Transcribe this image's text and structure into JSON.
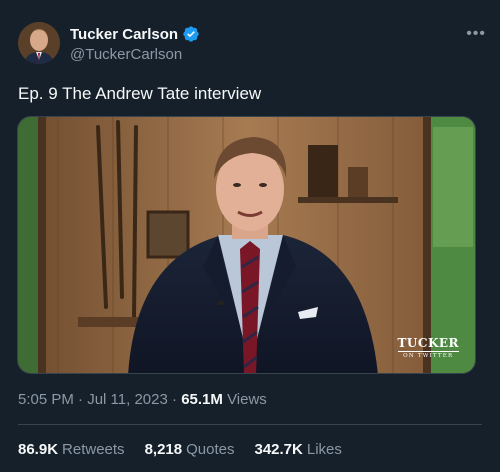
{
  "author": {
    "display_name": "Tucker Carlson",
    "handle": "@TuckerCarlson",
    "verified_color": "#1d9bf0"
  },
  "more_icon": "•••",
  "tweet": {
    "text": "Ep. 9  The Andrew Tate interview"
  },
  "media": {
    "watermark_main": "TUCKER",
    "watermark_sub": "ON TWITTER"
  },
  "meta": {
    "time": "5:05 PM",
    "separator1": " · ",
    "date": "Jul 11, 2023",
    "separator2": " · ",
    "views_count": "65.1M",
    "views_label": "Views"
  },
  "stats": {
    "retweets_count": "86.9K",
    "retweets_label": "Retweets",
    "quotes_count": "8,218",
    "quotes_label": "Quotes",
    "likes_count": "342.7K",
    "likes_label": "Likes"
  },
  "colors": {
    "background": "#15202b",
    "primary_text": "#f7f9f9",
    "secondary_text": "#8b98a5",
    "border": "#38444d",
    "accent": "#1d9bf0"
  }
}
